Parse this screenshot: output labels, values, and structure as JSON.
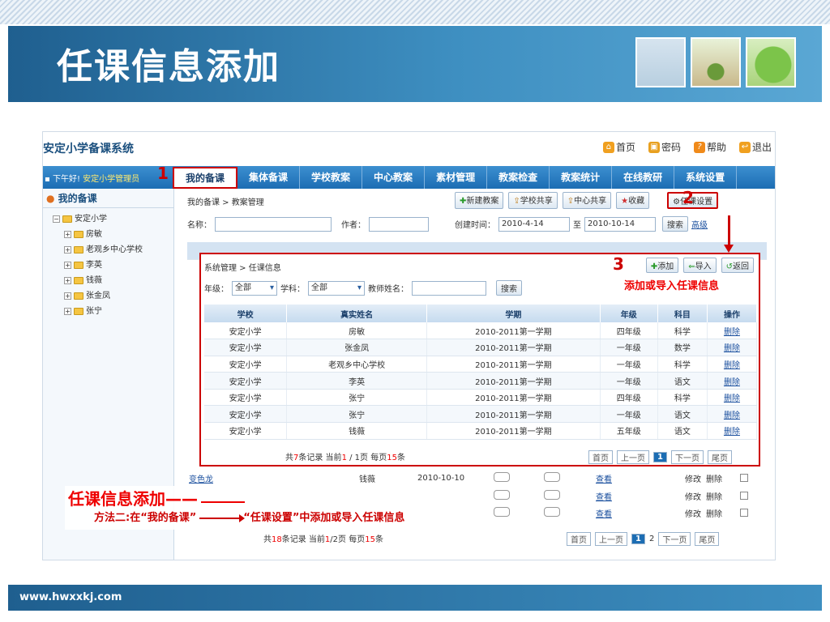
{
  "slide": {
    "title": "任课信息添加",
    "footer_url": "www.hwxxkj.com"
  },
  "app": {
    "system_title": "安定小学备课系统",
    "top_links": [
      {
        "label": "首页",
        "icon": "home-icon",
        "color": "#f0a020"
      },
      {
        "label": "密码",
        "icon": "lock-icon",
        "color": "#e8a020"
      },
      {
        "label": "帮助",
        "icon": "help-icon",
        "color": "#f08a1a"
      },
      {
        "label": "退出",
        "icon": "logout-icon",
        "color": "#f0a020"
      }
    ],
    "greeting_prefix": "下午好!",
    "greeting_user": "安定小学管理员",
    "nav_tabs": [
      "我的备课",
      "集体备课",
      "学校教案",
      "中心教案",
      "素材管理",
      "教案检查",
      "教案统计",
      "在线教研",
      "系统设置"
    ],
    "sidebar": {
      "title": "我的备课",
      "root": "安定小学",
      "items": [
        "房敏",
        "老观乡中心学校",
        "李英",
        "钱薇",
        "张金凤",
        "张宁"
      ]
    },
    "main": {
      "breadcrumb": "我的备课 > 教案管理",
      "buttons": [
        "新建教案",
        "学校共享",
        "中心共享",
        "收藏"
      ],
      "settings_button": "任课设置",
      "filter": {
        "name_label": "名称：",
        "author_label": "作者：",
        "created_label": "创建时间：",
        "date_from": "2010-4-14",
        "to": "至",
        "date_to": "2010-10-14",
        "search": "搜索",
        "advanced": "高级"
      },
      "visible_row": {
        "title": "变色龙",
        "author": "钱薇",
        "date": "2010-10-10",
        "view": "查看",
        "edit": "修改",
        "delete": "删除"
      },
      "view": "查看",
      "edit": "修改",
      "delete": "删除",
      "pager": {
        "prefix": "共",
        "total": "18",
        "mid": "条记录 当前",
        "current": "1",
        "slash": "/",
        "pages": "2",
        "suffix_a": "页 每页",
        "per": "15",
        "suffix_b": "条",
        "first": "首页",
        "prev": "上一页",
        "p1": "1",
        "p2": "2",
        "next": "下一页",
        "last": "尾页"
      }
    },
    "overlay": {
      "breadcrumb": "系统管理 > 任课信息",
      "buttons": [
        {
          "label": "添加",
          "icon": "plus-icon"
        },
        {
          "label": "导入",
          "icon": "import-icon"
        },
        {
          "label": "返回",
          "icon": "back-icon"
        }
      ],
      "filter": {
        "grade_label": "年级：",
        "grade_value": "全部",
        "subject_label": "学科：",
        "subject_value": "全部",
        "teacher_label": "教师姓名：",
        "search": "搜索"
      },
      "columns": [
        "学校",
        "真实姓名",
        "学期",
        "年级",
        "科目",
        "操作"
      ],
      "rows": [
        [
          "安定小学",
          "房敏",
          "2010-2011第一学期",
          "四年级",
          "科学",
          "删除"
        ],
        [
          "安定小学",
          "张金凤",
          "2010-2011第一学期",
          "一年级",
          "数学",
          "删除"
        ],
        [
          "安定小学",
          "老观乡中心学校",
          "2010-2011第一学期",
          "一年级",
          "科学",
          "删除"
        ],
        [
          "安定小学",
          "李英",
          "2010-2011第一学期",
          "一年级",
          "语文",
          "删除"
        ],
        [
          "安定小学",
          "张宁",
          "2010-2011第一学期",
          "四年级",
          "科学",
          "删除"
        ],
        [
          "安定小学",
          "张宁",
          "2010-2011第一学期",
          "一年级",
          "语文",
          "删除"
        ],
        [
          "安定小学",
          "钱薇",
          "2010-2011第一学期",
          "五年级",
          "语文",
          "删除"
        ]
      ],
      "pager": {
        "prefix": "共",
        "total": "7",
        "mid": "条记录 当前",
        "current": "1",
        "slash": " / ",
        "pages": "1",
        "suffix_a": "页 每页",
        "per": "15",
        "suffix_b": "条",
        "first": "首页",
        "prev": "上一页",
        "p1": "1",
        "next": "下一页",
        "last": "尾页"
      }
    }
  },
  "annotations": {
    "n1": "1",
    "n2": "2",
    "n3": "3",
    "overlay_note": "添加或导入任课信息",
    "callout_title": "任课信息添加——",
    "callout_part1": "方法二:在“我的备课”",
    "callout_part2": "“任课设置”中添加或导入任课信息"
  }
}
